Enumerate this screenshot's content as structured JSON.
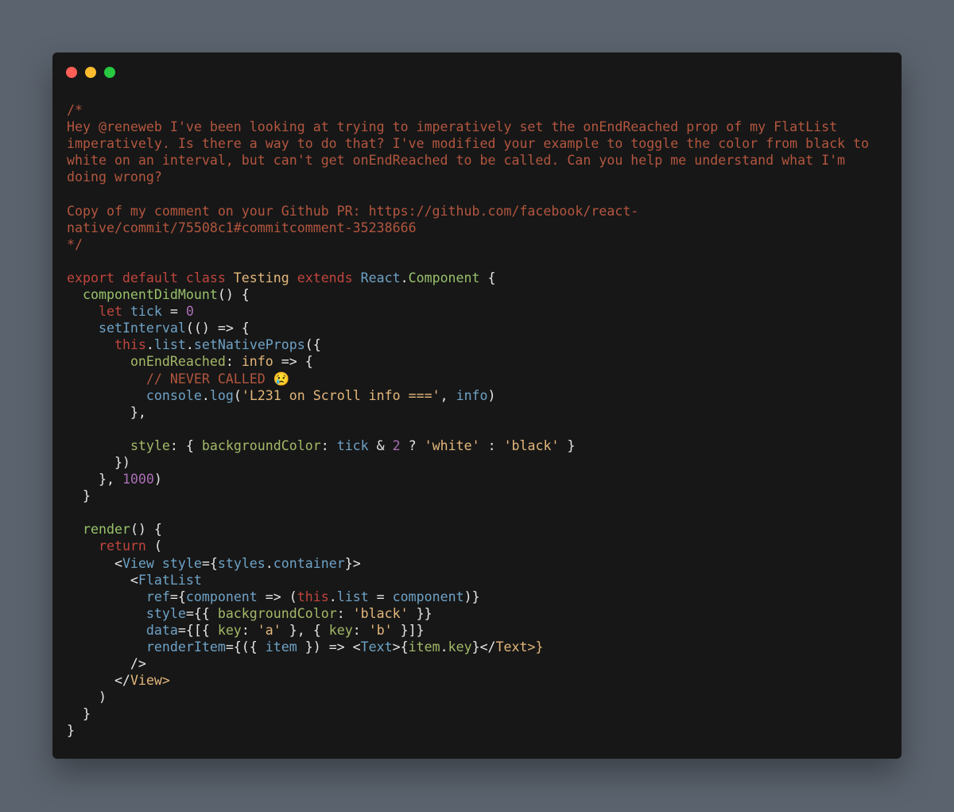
{
  "window": {
    "controls": [
      {
        "name": "close",
        "color": "#ff5f57"
      },
      {
        "name": "minimize",
        "color": "#febc2e"
      },
      {
        "name": "maximize",
        "color": "#28c840"
      }
    ]
  },
  "colors": {
    "background": "#5b636e",
    "editor_background": "#171717",
    "comment": "#b3563f",
    "keyword": "#c0453d",
    "string": "#e4b77b",
    "builtin": "#6ea2c6",
    "function": "#98c16b",
    "number": "#a96fb5"
  },
  "code": {
    "language": "jsx",
    "lines": [
      [
        [
          "comment",
          "/*"
        ]
      ],
      [
        [
          "comment",
          "Hey @reneweb I've been looking at trying to imperatively set the onEndReached prop of my FlatList"
        ]
      ],
      [
        [
          "comment",
          "imperatively. Is there a way to do that? I've modified your example to toggle the color from black to"
        ]
      ],
      [
        [
          "comment",
          "white on an interval, but can't get onEndReached to be called. Can you help me understand what I'm"
        ]
      ],
      [
        [
          "comment",
          "doing wrong?"
        ]
      ],
      [],
      [
        [
          "comment",
          "Copy of my comment on your Github PR: https://github.com/facebook/react-"
        ]
      ],
      [
        [
          "comment",
          "native/commit/75508c1#commitcomment-35238666"
        ]
      ],
      [
        [
          "comment",
          "*/"
        ]
      ],
      [],
      [
        [
          "keyword",
          "export default class "
        ],
        [
          "class",
          "Testing"
        ],
        [
          "keyword",
          " extends "
        ],
        [
          "builtin",
          "React"
        ],
        [
          "punct",
          "."
        ],
        [
          "func",
          "Component"
        ],
        [
          "punct",
          " {"
        ]
      ],
      [
        [
          "punct",
          "  "
        ],
        [
          "func",
          "componentDidMount"
        ],
        [
          "punct",
          "() {"
        ]
      ],
      [
        [
          "punct",
          "    "
        ],
        [
          "keyword",
          "let"
        ],
        [
          "var",
          " tick"
        ],
        [
          "punct",
          " = "
        ],
        [
          "number",
          "0"
        ]
      ],
      [
        [
          "punct",
          "    "
        ],
        [
          "builtin",
          "setInterval"
        ],
        [
          "punct",
          "(() => {"
        ]
      ],
      [
        [
          "punct",
          "      "
        ],
        [
          "keyword",
          "this"
        ],
        [
          "punct",
          "."
        ],
        [
          "builtin",
          "list"
        ],
        [
          "punct",
          "."
        ],
        [
          "builtin",
          "setNativeProps"
        ],
        [
          "punct",
          "({"
        ]
      ],
      [
        [
          "punct",
          "        "
        ],
        [
          "prop",
          "onEndReached"
        ],
        [
          "punct",
          ": "
        ],
        [
          "class",
          "info"
        ],
        [
          "punct",
          " => {"
        ]
      ],
      [
        [
          "punct",
          "          "
        ],
        [
          "comment",
          "// NEVER CALLED 😢"
        ]
      ],
      [
        [
          "punct",
          "          "
        ],
        [
          "builtin",
          "console"
        ],
        [
          "punct",
          "."
        ],
        [
          "builtin",
          "log"
        ],
        [
          "punct",
          "("
        ],
        [
          "string",
          "'L231 on Scroll info ==='"
        ],
        [
          "punct",
          ", "
        ],
        [
          "var",
          "info"
        ],
        [
          "punct",
          ")"
        ]
      ],
      [
        [
          "punct",
          "        },"
        ]
      ],
      [],
      [
        [
          "punct",
          "        "
        ],
        [
          "prop",
          "style"
        ],
        [
          "punct",
          ": { "
        ],
        [
          "prop",
          "backgroundColor"
        ],
        [
          "punct",
          ": "
        ],
        [
          "var",
          "tick"
        ],
        [
          "punct",
          " & "
        ],
        [
          "number",
          "2"
        ],
        [
          "punct",
          " ? "
        ],
        [
          "string",
          "'white'"
        ],
        [
          "punct",
          " : "
        ],
        [
          "string",
          "'black'"
        ],
        [
          "punct",
          " }"
        ]
      ],
      [
        [
          "punct",
          "      })"
        ]
      ],
      [
        [
          "punct",
          "    }, "
        ],
        [
          "number",
          "1000"
        ],
        [
          "punct",
          ")"
        ]
      ],
      [
        [
          "punct",
          "  }"
        ]
      ],
      [],
      [
        [
          "punct",
          "  "
        ],
        [
          "func",
          "render"
        ],
        [
          "punct",
          "() {"
        ]
      ],
      [
        [
          "punct",
          "    "
        ],
        [
          "keyword",
          "return"
        ],
        [
          "punct",
          " ("
        ]
      ],
      [
        [
          "punct",
          "      <"
        ],
        [
          "tag",
          "View"
        ],
        [
          "attr",
          " style"
        ],
        [
          "punct",
          "={"
        ],
        [
          "builtin",
          "styles"
        ],
        [
          "punct",
          "."
        ],
        [
          "builtin",
          "container"
        ],
        [
          "punct",
          "}>"
        ]
      ],
      [
        [
          "punct",
          "        <"
        ],
        [
          "tag",
          "FlatList"
        ]
      ],
      [
        [
          "punct",
          "          "
        ],
        [
          "attr",
          "ref"
        ],
        [
          "punct",
          "={"
        ],
        [
          "var",
          "component"
        ],
        [
          "punct",
          " => ("
        ],
        [
          "keyword",
          "this"
        ],
        [
          "punct",
          "."
        ],
        [
          "builtin",
          "list"
        ],
        [
          "punct",
          " = "
        ],
        [
          "var",
          "component"
        ],
        [
          "punct",
          ")}"
        ]
      ],
      [
        [
          "punct",
          "          "
        ],
        [
          "attr",
          "style"
        ],
        [
          "punct",
          "={{ "
        ],
        [
          "prop",
          "backgroundColor"
        ],
        [
          "punct",
          ": "
        ],
        [
          "string",
          "'black'"
        ],
        [
          "punct",
          " }}"
        ]
      ],
      [
        [
          "punct",
          "          "
        ],
        [
          "attr",
          "data"
        ],
        [
          "punct",
          "={[{ "
        ],
        [
          "prop",
          "key"
        ],
        [
          "punct",
          ": "
        ],
        [
          "string",
          "'a'"
        ],
        [
          "punct",
          " }, { "
        ],
        [
          "prop",
          "key"
        ],
        [
          "punct",
          ": "
        ],
        [
          "string",
          "'b'"
        ],
        [
          "punct",
          " }]}"
        ]
      ],
      [
        [
          "punct",
          "          "
        ],
        [
          "attr",
          "renderItem"
        ],
        [
          "punct",
          "={({ "
        ],
        [
          "var",
          "item"
        ],
        [
          "punct",
          " }) => <"
        ],
        [
          "tag",
          "Text"
        ],
        [
          "punct",
          ">{"
        ],
        [
          "prop",
          "item"
        ],
        [
          "punct",
          "."
        ],
        [
          "prop",
          "key"
        ],
        [
          "punct",
          "}</"
        ],
        [
          "class",
          "Text"
        ],
        [
          "class",
          ">}"
        ]
      ],
      [
        [
          "punct",
          "        />"
        ]
      ],
      [
        [
          "punct",
          "      </"
        ],
        [
          "class",
          "View"
        ],
        [
          "class",
          ">"
        ]
      ],
      [
        [
          "punct",
          "    )"
        ]
      ],
      [
        [
          "punct",
          "  }"
        ]
      ],
      [
        [
          "punct",
          "}"
        ]
      ]
    ]
  }
}
